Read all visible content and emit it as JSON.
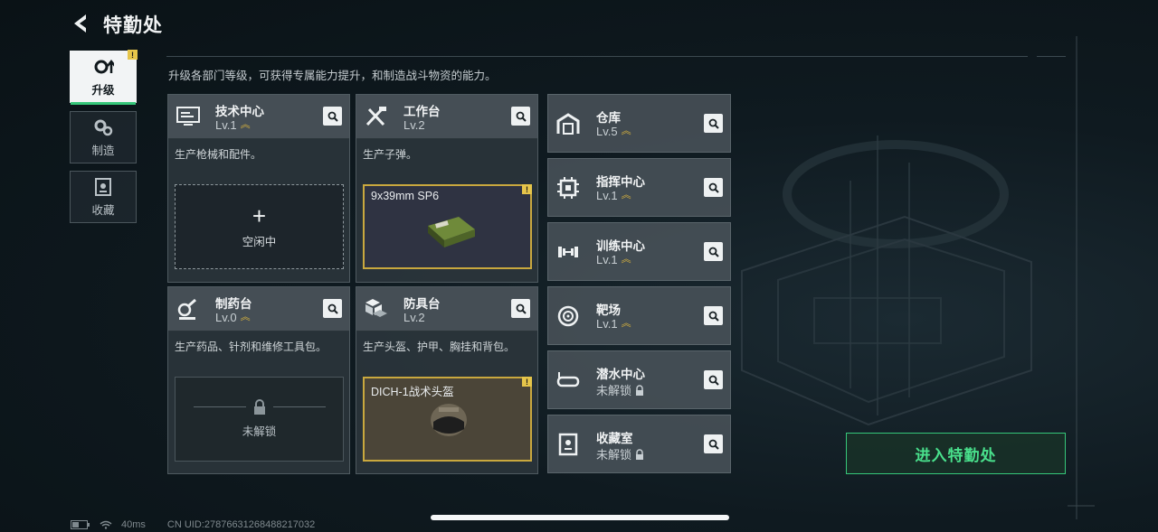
{
  "header": {
    "title": "特勤处",
    "subtitle": "升级各部门等级，可获得专属能力提升，和制造战斗物资的能力。"
  },
  "nav": [
    {
      "label": "升级",
      "icon": "upgrade-gear-icon",
      "active": true
    },
    {
      "label": "制造",
      "icon": "craft-gears-icon",
      "active": false
    },
    {
      "label": "收藏",
      "icon": "collection-icon",
      "active": false
    }
  ],
  "cards": [
    {
      "name": "技术中心",
      "level": "Lv.1",
      "icon": "monitor-icon",
      "desc": "生产枪械和配件。",
      "slot": {
        "state": "idle",
        "label": "空闲中"
      }
    },
    {
      "name": "工作台",
      "level": "Lv.2",
      "icon": "tools-icon",
      "desc": "生产子弹。",
      "slot": {
        "state": "producing",
        "item": "9x39mm SP6"
      }
    },
    {
      "name": "制药台",
      "level": "Lv.0",
      "icon": "microscope-icon",
      "desc": "生产药品、针剂和维修工具包。",
      "slot": {
        "state": "locked",
        "label": "未解锁"
      }
    },
    {
      "name": "防具台",
      "level": "Lv.2",
      "icon": "armor-cubes-icon",
      "desc": "生产头盔、护甲、胸挂和背包。",
      "slot": {
        "state": "producing",
        "item": "DICH-1战术头盔"
      }
    }
  ],
  "side_cards": [
    {
      "name": "仓库",
      "level": "Lv.5",
      "icon": "warehouse-icon"
    },
    {
      "name": "指挥中心",
      "level": "Lv.1",
      "icon": "chip-icon"
    },
    {
      "name": "训练中心",
      "level": "Lv.1",
      "icon": "dumbbell-icon"
    },
    {
      "name": "靶场",
      "level": "Lv.1",
      "icon": "target-icon"
    },
    {
      "name": "潜水中心",
      "level": "未解锁",
      "icon": "diving-mask-icon",
      "locked": true
    },
    {
      "name": "收藏室",
      "level": "未解锁",
      "icon": "vault-icon",
      "locked": true
    }
  ],
  "enter_button": "进入特勤处",
  "status": {
    "ping": "40ms",
    "uid": "CN UID:27876631268488217032"
  },
  "badge_text": "!",
  "colors": {
    "accent_green": "#36c77a",
    "warning_yellow": "#e6c54a",
    "production_gold": "#c9a83e"
  }
}
